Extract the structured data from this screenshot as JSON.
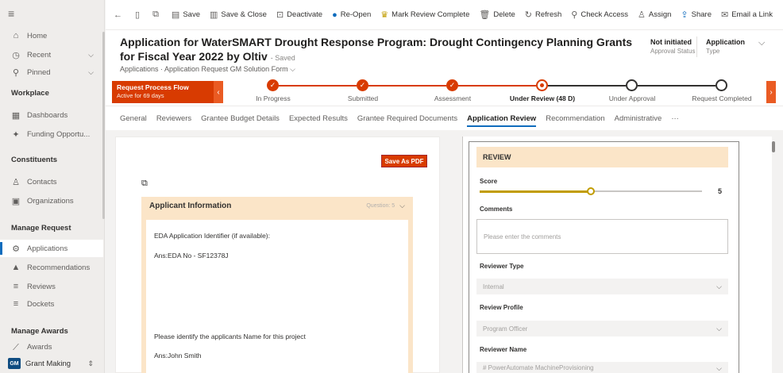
{
  "sidebar": {
    "recent": "Recent",
    "pinned": "Pinned",
    "home": "Home",
    "workplace": "Workplace",
    "dashboards": "Dashboards",
    "funding": "Funding Opportu...",
    "constituents": "Constituents",
    "contacts": "Contacts",
    "organizations": "Organizations",
    "manage_request": "Manage Request",
    "applications": "Applications",
    "recommendations": "Recommendations",
    "reviews": "Reviews",
    "dockets": "Dockets",
    "manage_awards": "Manage Awards",
    "awards": "Awards",
    "area_badge": "GM",
    "area_name": "Grant Making"
  },
  "toolbar": {
    "save": "Save",
    "save_close": "Save & Close",
    "deactivate": "Deactivate",
    "reopen": "Re-Open",
    "mark_review": "Mark Review Complete",
    "delete": "Delete",
    "refresh": "Refresh",
    "check_access": "Check Access",
    "assign": "Assign",
    "share": "Share",
    "email_link": "Email a Link"
  },
  "header": {
    "title": "Application for WaterSMART Drought Response Program: Drought Contingency Planning Grants for Fiscal Year 2022 by Oltiv",
    "saved": "- Saved",
    "subtitle": "Applications  ·  Application Request GM Solution Form  ⌵",
    "approval_value": "Not initiated",
    "approval_label": "Approval Status",
    "type_value": "Application",
    "type_label": "Type"
  },
  "process": {
    "name": "Request Process Flow",
    "age": "Active for 69 days",
    "stages": [
      {
        "label": "In Progress",
        "state": "done"
      },
      {
        "label": "Submitted",
        "state": "done"
      },
      {
        "label": "Assessment",
        "state": "done"
      },
      {
        "label": "Under Review  (48 D)",
        "state": "current"
      },
      {
        "label": "Under Approval",
        "state": "todo"
      },
      {
        "label": "Request Completed",
        "state": "todo"
      }
    ]
  },
  "tabs": [
    "General",
    "Reviewers",
    "Grantee Budget Details",
    "Expected Results",
    "Grantee Required Documents",
    "Application Review",
    "Recommendation",
    "Administrative",
    "···"
  ],
  "left": {
    "save_pdf": "Save As PDF",
    "card_title": "Applicant Information",
    "card_meta": "Question: 5",
    "q1": "EDA Application Identifier (if available):",
    "a1": "Ans:EDA No - SF12378J",
    "q2": "Please identify the applicants Name for this project",
    "a2": "Ans:John Smith"
  },
  "review": {
    "title": "REVIEW",
    "score_label": "Score",
    "score_value": "5",
    "score_fraction": 0.5,
    "comments_label": "Comments",
    "comments_placeholder": "Please enter the comments",
    "reviewer_type_label": "Reviewer Type",
    "reviewer_type_value": "Internal",
    "review_profile_label": "Review Profile",
    "review_profile_value": "Program Officer",
    "reviewer_name_label": "Reviewer Name",
    "reviewer_name_value": "# PowerAutomate MachineProvisioning"
  },
  "colors": {
    "accent": "#d83b01",
    "brand": "#0f6cbd",
    "card": "#fbe5c8"
  }
}
